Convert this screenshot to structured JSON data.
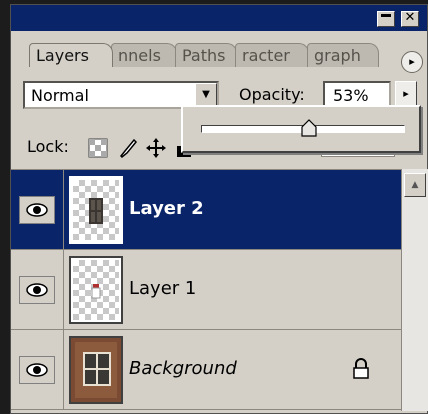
{
  "window": {
    "minimize_label": "",
    "close_label": "✕"
  },
  "tabs": [
    {
      "label": "Layers",
      "active": true
    },
    {
      "label": "nnels",
      "active": false
    },
    {
      "label": "Paths",
      "active": false
    },
    {
      "label": "racter",
      "active": false
    },
    {
      "label": "graph",
      "active": false
    }
  ],
  "panel_menu_icon": "▸",
  "blend_mode": {
    "value": "Normal",
    "arrow": "▼"
  },
  "opacity": {
    "label": "Opacity:",
    "value": "53%",
    "arrow": "▸",
    "slider_percent": 53
  },
  "lock": {
    "label": "Lock:"
  },
  "layers": [
    {
      "name": "Layer 2",
      "selected": true,
      "italic": false,
      "locked": false
    },
    {
      "name": "Layer 1",
      "selected": false,
      "italic": false,
      "locked": false
    },
    {
      "name": "Background",
      "selected": false,
      "italic": true,
      "locked": true
    }
  ],
  "scrollbar": {
    "up_arrow": "▲"
  },
  "colors": {
    "selection": "#0a246a",
    "panel": "#d4d0c8",
    "titlebar": "#0a246a"
  }
}
